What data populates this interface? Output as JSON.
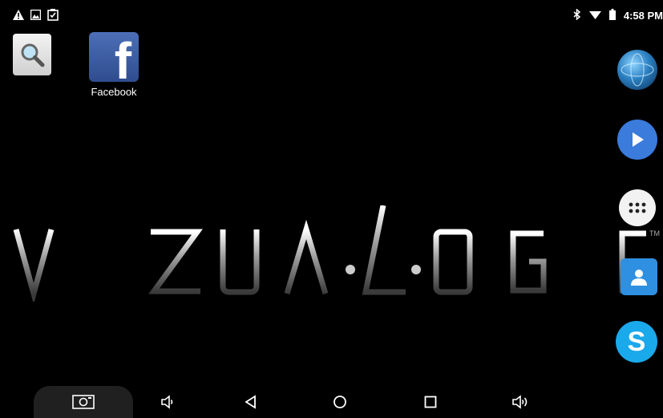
{
  "status_bar": {
    "time": "4:58 PM",
    "left_icons": [
      "warning-icon",
      "image-icon",
      "clipboard-icon"
    ],
    "right_icons": [
      "bluetooth-icon",
      "wifi-icon",
      "battery-icon"
    ]
  },
  "desktop": {
    "apps": [
      {
        "name": "search",
        "icon": "search-icon",
        "label": ""
      },
      {
        "name": "facebook",
        "icon": "facebook-icon",
        "label": "Facebook"
      }
    ],
    "logo_text": "VIZUALOGIC",
    "trademark": "TM"
  },
  "dock": {
    "items": [
      "browser-globe-icon",
      "play-icon",
      "app-drawer-icon",
      "contacts-icon",
      "skype-icon"
    ]
  },
  "nav_bar": {
    "buttons": [
      "screenshot-icon",
      "volume-down-icon",
      "back-icon",
      "home-icon",
      "recents-icon",
      "volume-up-icon"
    ]
  },
  "colors": {
    "background": "#000000",
    "facebook_blue": "#3b5998",
    "play_blue": "#3a7bdc",
    "skype_blue": "#1aa9ea",
    "contacts_blue": "#2f8fe0"
  }
}
